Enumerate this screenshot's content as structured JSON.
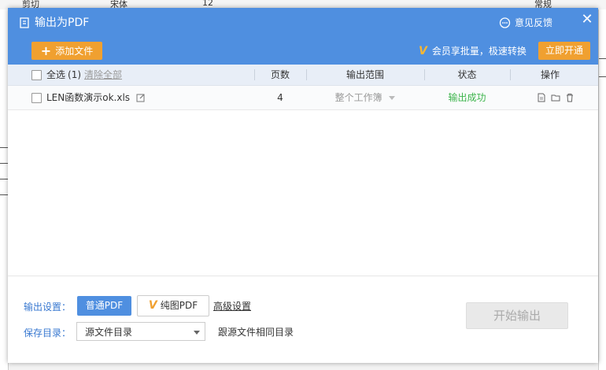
{
  "background": {
    "toolbar_items": [
      "剪切",
      "宋体",
      "12",
      "常规"
    ]
  },
  "dialog": {
    "title": "输出为PDF",
    "feedback_label": "意见反馈",
    "close_glyph": "✕",
    "add_file_label": "添加文件",
    "vip_text": "会员享批量，极速转换",
    "open_vip_label": "立即开通"
  },
  "table": {
    "select_all_label": "全选",
    "select_all_count": "(1)",
    "clear_all_label": "清除全部",
    "headers": {
      "pages": "页数",
      "range": "输出范围",
      "status": "状态",
      "actions": "操作"
    },
    "rows": [
      {
        "filename": "LEN函数演示ok.xls",
        "pages": "4",
        "range": "整个工作簿",
        "status": "输出成功"
      }
    ]
  },
  "footer": {
    "output_settings_label": "输出设置：",
    "normal_pdf_label": "普通PDF",
    "pure_pdf_label": "纯图PDF",
    "advanced_label": "高级设置",
    "save_dir_label": "保存目录：",
    "save_dir_value": "源文件目录",
    "same_dir_label": "跟源文件相同目录",
    "start_label": "开始输出"
  },
  "colors": {
    "header_blue": "#4f8fe0",
    "accent_orange": "#f0a030",
    "success_green": "#3cb44b",
    "label_blue": "#3878d0"
  }
}
